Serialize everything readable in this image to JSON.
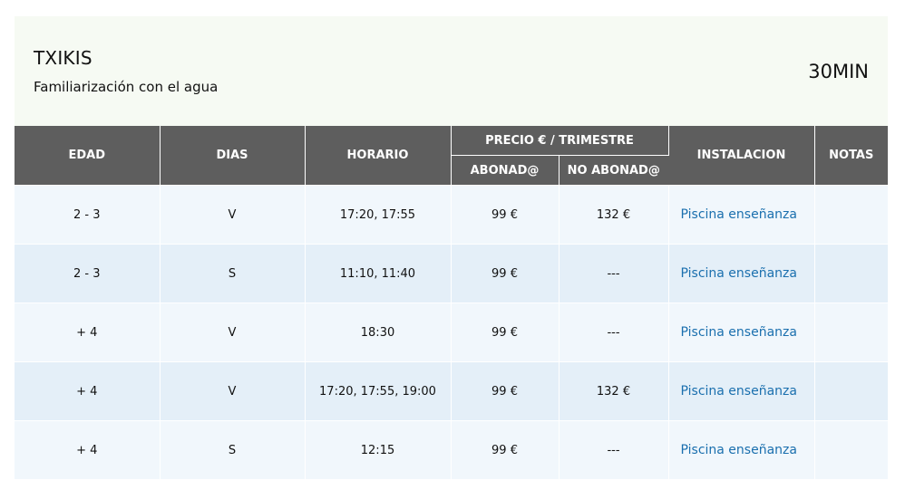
{
  "header": {
    "title": "TXIKIS",
    "subtitle": "Familiarización con el agua",
    "duration": "30MIN"
  },
  "table": {
    "headers": {
      "edad": "EDAD",
      "dias": "DIAS",
      "horario": "HORARIO",
      "precio": "PRECIO € / TRIMESTRE",
      "abonado": "ABONAD@",
      "no_abonado": "NO ABONAD@",
      "instalacion": "INSTALACION",
      "notas": "NOTAS"
    },
    "rows": [
      {
        "edad": "2 - 3",
        "dias": "V",
        "horario": "17:20, 17:55",
        "abonado": "99 €",
        "no_abonado": "132 €",
        "instalacion": "Piscina enseñanza",
        "notas": ""
      },
      {
        "edad": "2 - 3",
        "dias": "S",
        "horario": "11:10, 11:40",
        "abonado": "99 €",
        "no_abonado": "---",
        "instalacion": "Piscina enseñanza",
        "notas": ""
      },
      {
        "edad": "+ 4",
        "dias": "V",
        "horario": "18:30",
        "abonado": "99 €",
        "no_abonado": "---",
        "instalacion": "Piscina enseñanza",
        "notas": ""
      },
      {
        "edad": "+ 4",
        "dias": "V",
        "horario": "17:20, 17:55, 19:00",
        "abonado": "99 €",
        "no_abonado": "132 €",
        "instalacion": "Piscina enseñanza",
        "notas": ""
      },
      {
        "edad": "+ 4",
        "dias": "S",
        "horario": "12:15",
        "abonado": "99 €",
        "no_abonado": "---",
        "instalacion": "Piscina enseñanza",
        "notas": ""
      }
    ]
  },
  "colors": {
    "header_bg": "#f6faf3",
    "table_head_bg": "#5e5e5e",
    "row_odd_bg": "#f1f7fc",
    "row_even_bg": "#e4eff8",
    "link": "#1a6fae"
  }
}
